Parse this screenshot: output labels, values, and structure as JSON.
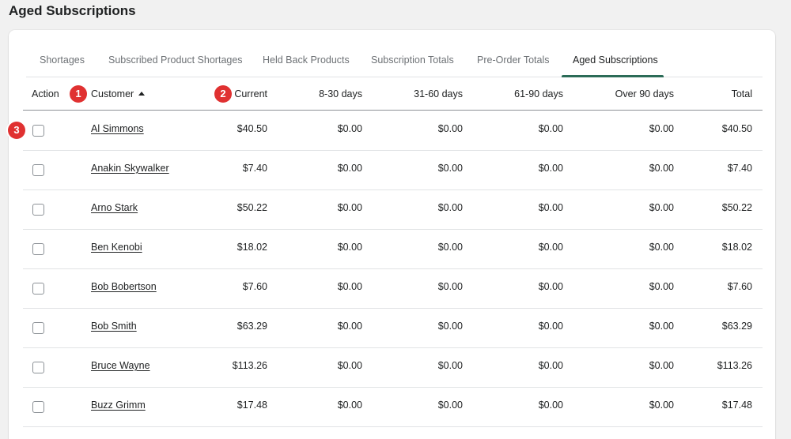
{
  "page": {
    "title": "Aged Subscriptions"
  },
  "tabs": [
    {
      "label": "Shortages",
      "active": false
    },
    {
      "label": "Subscribed Product Shortages",
      "active": false
    },
    {
      "label": "Held Back Products",
      "active": false
    },
    {
      "label": "Subscription Totals",
      "active": false
    },
    {
      "label": "Pre-Order Totals",
      "active": false
    },
    {
      "label": "Aged Subscriptions",
      "active": true
    }
  ],
  "table": {
    "columns": {
      "action": "Action",
      "customer": "Customer",
      "current": "Current",
      "d8_30": "8-30 days",
      "d31_60": "31-60 days",
      "d61_90": "61-90 days",
      "over90": "Over 90 days",
      "total": "Total"
    },
    "sort": {
      "column": "customer",
      "direction": "ascending"
    },
    "rows": [
      {
        "customer": "Al Simmons",
        "current": "$40.50",
        "d8_30": "$0.00",
        "d31_60": "$0.00",
        "d61_90": "$0.00",
        "over90": "$0.00",
        "total": "$40.50"
      },
      {
        "customer": "Anakin Skywalker",
        "current": "$7.40",
        "d8_30": "$0.00",
        "d31_60": "$0.00",
        "d61_90": "$0.00",
        "over90": "$0.00",
        "total": "$7.40"
      },
      {
        "customer": "Arno Stark",
        "current": "$50.22",
        "d8_30": "$0.00",
        "d31_60": "$0.00",
        "d61_90": "$0.00",
        "over90": "$0.00",
        "total": "$50.22"
      },
      {
        "customer": "Ben Kenobi",
        "current": "$18.02",
        "d8_30": "$0.00",
        "d31_60": "$0.00",
        "d61_90": "$0.00",
        "over90": "$0.00",
        "total": "$18.02"
      },
      {
        "customer": "Bob Bobertson",
        "current": "$7.60",
        "d8_30": "$0.00",
        "d31_60": "$0.00",
        "d61_90": "$0.00",
        "over90": "$0.00",
        "total": "$7.60"
      },
      {
        "customer": "Bob Smith",
        "current": "$63.29",
        "d8_30": "$0.00",
        "d31_60": "$0.00",
        "d61_90": "$0.00",
        "over90": "$0.00",
        "total": "$63.29"
      },
      {
        "customer": "Bruce Wayne",
        "current": "$113.26",
        "d8_30": "$0.00",
        "d31_60": "$0.00",
        "d61_90": "$0.00",
        "over90": "$0.00",
        "total": "$113.26"
      },
      {
        "customer": "Buzz Grimm",
        "current": "$17.48",
        "d8_30": "$0.00",
        "d31_60": "$0.00",
        "d61_90": "$0.00",
        "over90": "$0.00",
        "total": "$17.48"
      }
    ]
  },
  "annotations": {
    "badge_1": "1",
    "badge_2": "2",
    "badge_3": "3"
  },
  "colors": {
    "active_tab": "#2b6b57",
    "badge": "#e03131"
  }
}
